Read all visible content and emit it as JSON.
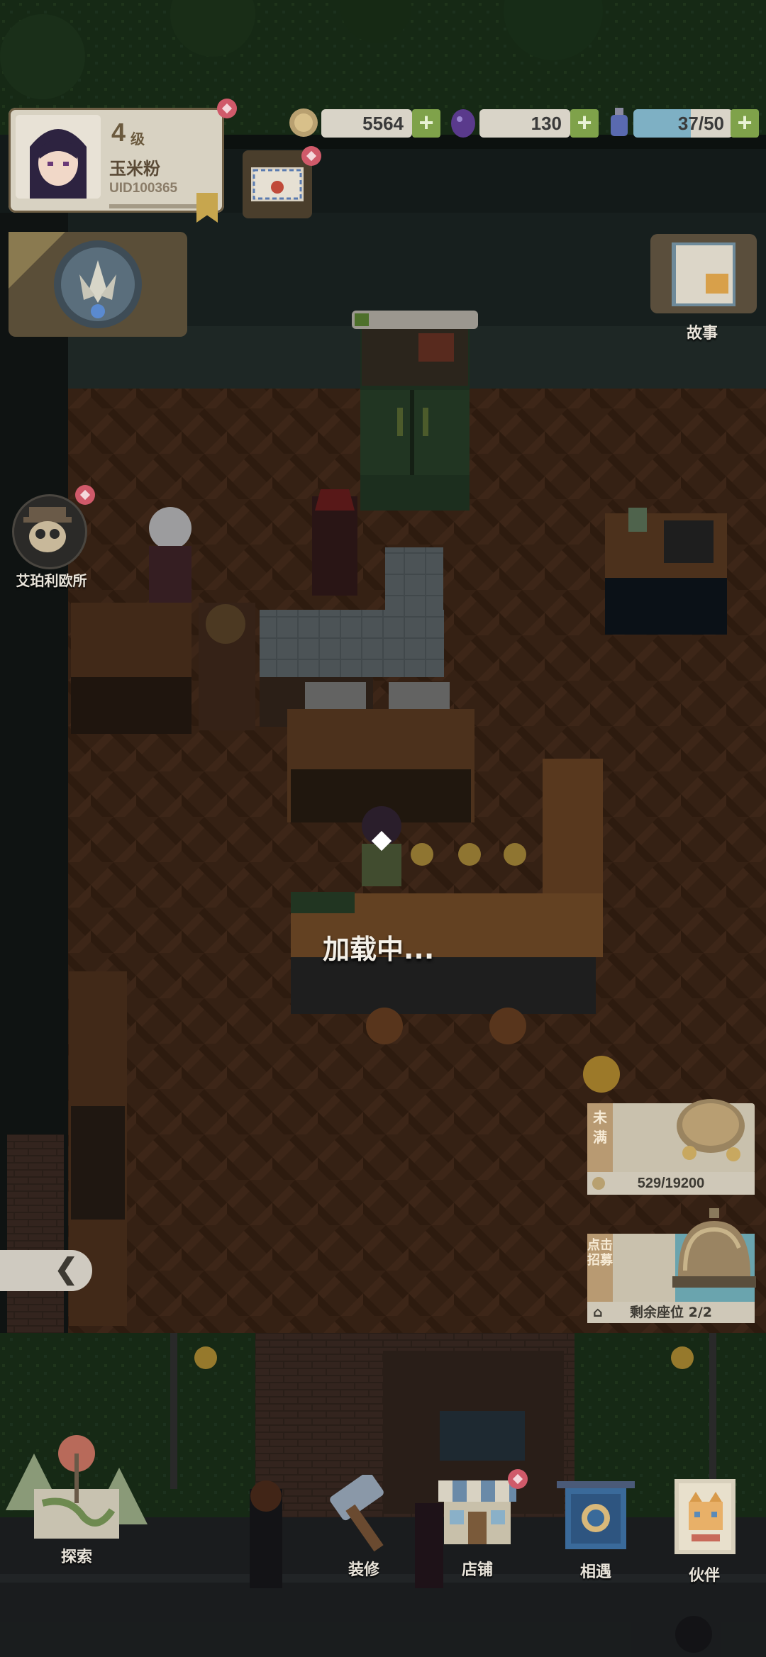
{
  "player": {
    "level": "4",
    "level_unit": "级",
    "nickname": "玉米粉",
    "uid": "UID100365"
  },
  "resources": {
    "coins": "5564",
    "gems": "130",
    "energy": "37/50",
    "plus": "+"
  },
  "side_menu": {
    "story_label": "故事",
    "npc_label": "艾珀利欧所"
  },
  "loading": {
    "text": "加载中..."
  },
  "earnings_panel": {
    "tag": "未满",
    "progress": "529/19200",
    "fill_fraction": 0.0276
  },
  "recruit_panel": {
    "tag": "点击招募",
    "seats": "剩余座位 2/2"
  },
  "back_tab": {
    "glyph": "❮"
  },
  "bottom_nav": {
    "explore": "探索",
    "decorate": "装修",
    "shop": "店铺",
    "encounter": "相遇",
    "partner": "伙伴"
  },
  "colors": {
    "floor": "#4a2e1c",
    "wall": "#1d2a28",
    "accent_green": "#7fa24a",
    "badge_red": "#d05a6a"
  }
}
